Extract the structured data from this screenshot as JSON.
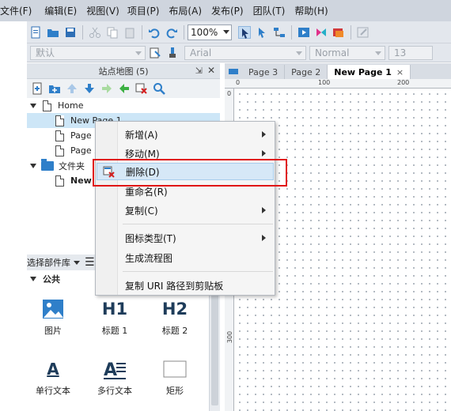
{
  "menu": [
    "文件(F)",
    "编辑(E)",
    "视图(V)",
    "项目(P)",
    "布局(A)",
    "发布(P)",
    "团队(T)",
    "帮助(H)"
  ],
  "toolbar": {
    "zoom": "100%"
  },
  "format_bar": {
    "font_preset": "默认",
    "font_family": "Arial",
    "font_style": "Normal",
    "font_size": "13"
  },
  "sitemap": {
    "title": "站点地图 (5)",
    "pin_icon": "⇲",
    "close_icon": "✕",
    "nodes": [
      {
        "label": "Home"
      },
      {
        "label": "New Page 1"
      },
      {
        "label": "Page 1"
      },
      {
        "label": "Page 2"
      },
      {
        "label": "文件夹"
      },
      {
        "label": "New"
      }
    ]
  },
  "library": {
    "title": "选择部件库",
    "category": "公共",
    "widgets": [
      {
        "label": "图片"
      },
      {
        "label": "标题 1"
      },
      {
        "label": "标题 2"
      },
      {
        "label": "单行文本"
      },
      {
        "label": "多行文本"
      },
      {
        "label": "矩形"
      }
    ],
    "glyphs": {
      "h1": "H1",
      "h2": "H2",
      "text_a": "A"
    }
  },
  "tabs": [
    {
      "label": "Page 3"
    },
    {
      "label": "Page 2"
    },
    {
      "label": "New Page 1",
      "close": "×"
    }
  ],
  "ruler": {
    "h": [
      "0",
      "100",
      "200"
    ],
    "v": [
      "0",
      "300"
    ]
  },
  "context_menu": {
    "items": [
      {
        "label": "新增(A)",
        "submenu": true
      },
      {
        "label": "移动(M)",
        "submenu": true
      },
      {
        "label": "删除(D)",
        "highlighted": true
      },
      {
        "label": "重命名(R)"
      },
      {
        "label": "复制(C)",
        "submenu": true
      },
      {
        "label": "图标类型(T)",
        "submenu": true
      },
      {
        "label": "生成流程图"
      },
      {
        "label": "复制 URI 路径到剪贴板"
      }
    ]
  },
  "colors": {
    "accent": "#2f7fc9",
    "highlight": "#e01515",
    "selection": "#cde6f7"
  }
}
